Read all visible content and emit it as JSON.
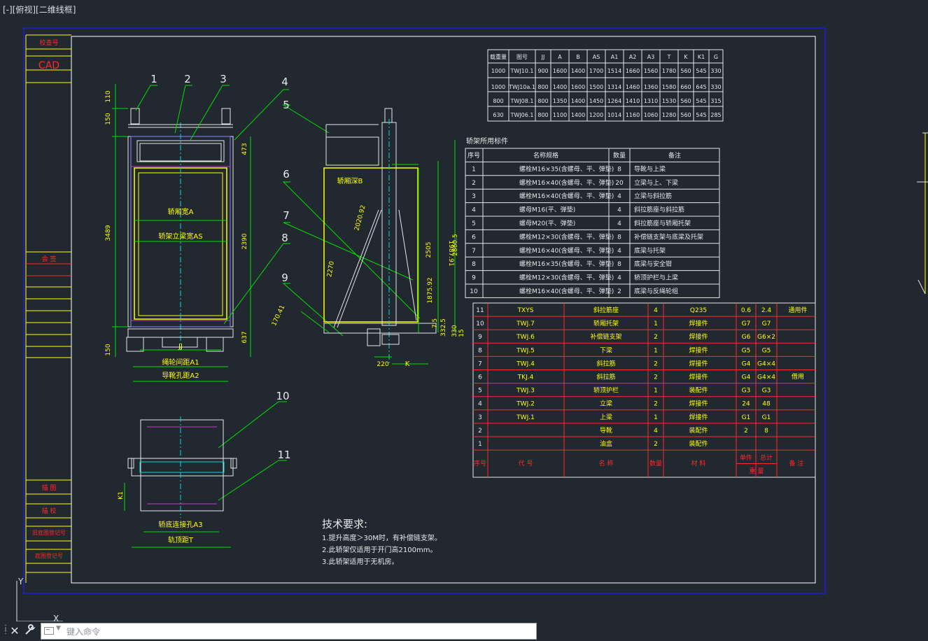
{
  "viewport_label": "[-][俯视][二维线框]",
  "colors": {
    "background": "#212830",
    "frame": "#ffffff",
    "outer_frame": "#1f1fd8",
    "table_red": "#ff2a2a",
    "geometry_white": "#e8e8e8",
    "yellow": "#ffff00",
    "green": "#00e000",
    "cyan": "#00d8d8",
    "magenta": "#d040d0"
  },
  "title_block": {
    "labels": [
      "校查号",
      "CAD",
      "会  签",
      "描  图",
      "描  校",
      "旧底图登记号",
      "底图登记号"
    ]
  },
  "spec_table": {
    "headers": [
      "载重量",
      "图号",
      "JJ",
      "A",
      "B",
      "AS",
      "A1",
      "A2",
      "A3",
      "T",
      "K",
      "K1",
      "G"
    ],
    "rows": [
      [
        "1000",
        "TWJ10.1",
        "900",
        "1600",
        "1400",
        "1700",
        "1514",
        "1660",
        "1560",
        "1780",
        "560",
        "545",
        "330"
      ],
      [
        "1000",
        "TWJ10a.1",
        "800",
        "1400",
        "1600",
        "1500",
        "1314",
        "1460",
        "1360",
        "1580",
        "660",
        "645",
        "330"
      ],
      [
        "800",
        "TWJ08.1",
        "800",
        "1350",
        "1400",
        "1450",
        "1264",
        "1410",
        "1310",
        "1530",
        "560",
        "545",
        "315"
      ],
      [
        "630",
        "TWJ06.1",
        "800",
        "1100",
        "1400",
        "1200",
        "1014",
        "1160",
        "1060",
        "1280",
        "560",
        "545",
        "285"
      ]
    ]
  },
  "parts_table": {
    "title": "轿架所用标件",
    "headers": [
      "序号",
      "名称规格",
      "数量",
      "备注"
    ],
    "rows": [
      [
        "1",
        "螺栓M16×35(含螺母、平、弹垫)",
        "8",
        "导靴与上梁"
      ],
      [
        "2",
        "螺栓M16×40(含螺母、平、弹垫)",
        "20",
        "立梁与上、下梁"
      ],
      [
        "3",
        "螺栓M16×40(含螺母、平、弹垫)",
        "4",
        "立梁与斜拉筋"
      ],
      [
        "4",
        "螺母M16(平、弹垫)",
        "4",
        "斜拉筋座与斜拉筋"
      ],
      [
        "5",
        "螺母M20(平、弹垫)",
        "4",
        "斜拉筋座与轿厢托架"
      ],
      [
        "6",
        "螺栓M12×30(含螺母、平、弹垫)",
        "8",
        "补偿链支架与底梁及托架"
      ],
      [
        "7",
        "螺栓M16×40(含螺母、平、弹垫)",
        "4",
        "底梁与托架"
      ],
      [
        "8",
        "螺栓M16×35(含螺母、平、弹垫)",
        "8",
        "底梁与安全钳"
      ],
      [
        "9",
        "螺栓M12×30(含螺母、平、弹垫)",
        "4",
        "轿顶护栏与上梁"
      ],
      [
        "10",
        "螺栓M16×40(含螺母、平、弹垫)",
        "2",
        "底梁与反绳轮组"
      ]
    ]
  },
  "bom_table": {
    "rows": [
      [
        "11",
        "TXYS",
        "斜拉筋座",
        "4",
        "Q235",
        "0.6",
        "2.4"
      ],
      [
        "10",
        "TWJ.7",
        "轿厢托架",
        "1",
        "焊接件",
        "G7",
        "G7"
      ],
      [
        "9",
        "TWJ.6",
        "补偿链支架",
        "2",
        "焊接件",
        "G6",
        "G6×2"
      ],
      [
        "8",
        "TWJ.5",
        "下梁",
        "1",
        "焊接件",
        "G5",
        "G5"
      ],
      [
        "7",
        "TWJ.4",
        "斜拉筋",
        "2",
        "焊接件",
        "G4",
        "G4×4"
      ],
      [
        "6",
        "TKJ.4",
        "斜拉筋",
        "2",
        "焊接件",
        "G4",
        "G4×4"
      ],
      [
        "5",
        "TWJ.3",
        "轿顶护栏",
        "1",
        "装配件",
        "G3",
        "G3"
      ],
      [
        "4",
        "TWJ.2",
        "立梁",
        "2",
        "焊接件",
        "24",
        "48"
      ],
      [
        "3",
        "TWJ.1",
        "上梁",
        "1",
        "焊接件",
        "G1",
        "G1"
      ],
      [
        "2",
        "",
        "导靴",
        "4",
        "装配件",
        "2",
        "8"
      ],
      [
        "1",
        "",
        "油盒",
        "2",
        "装配件",
        "",
        ""
      ]
    ],
    "remarks": [
      "通用件",
      "借用"
    ],
    "footer": {
      "seq": "序号",
      "code": "代    号",
      "name": "名    称",
      "qty": "数量",
      "material": "材    料",
      "single": "单件",
      "total": "总计",
      "weight": "重  量",
      "note": "备  注"
    }
  },
  "tech_notes": {
    "title": "技术要求:",
    "lines": [
      "1.提升高度＞30M时，有补偿链支架。",
      "2.此轿架仅适用于开门高2100mm。",
      "3.此轿架适用于无机房。"
    ]
  },
  "callouts": [
    "1",
    "2",
    "3",
    "4",
    "5",
    "6",
    "7",
    "8",
    "9",
    "10",
    "11"
  ],
  "front_view_labels": {
    "car_width": "轿厢宽A",
    "frame_width": "轿架立梁宽AS",
    "wheel_span": "绳轮间距A1",
    "guide_span": "导靴孔距A2",
    "jj": "JJ",
    "dims": [
      "110",
      "150",
      "3489",
      "473",
      "2390",
      "150",
      "637"
    ]
  },
  "side_view_labels": {
    "depth": "轿厢深B",
    "k": "K",
    "dims": [
      "2020.92",
      "2505",
      "2270",
      "2860.5",
      "1987.91",
      "1875.92",
      "170.41",
      "332.5",
      "330",
      "220",
      "15",
      "7.5"
    ]
  },
  "bottom_view_labels": {
    "connect": "轿底连接孔A3",
    "top_span": "轨顶距T",
    "k1": "K1"
  },
  "command_line": {
    "placeholder": "键入命令"
  }
}
